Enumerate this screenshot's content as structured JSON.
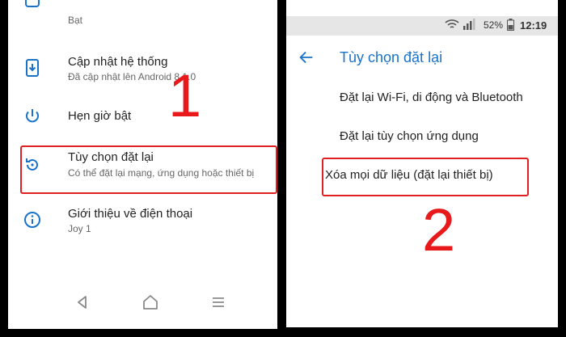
{
  "left": {
    "partial_item": {
      "subtitle": "Bạt"
    },
    "items": [
      {
        "title": "Cập nhật hệ thống",
        "subtitle": "Đã cập nhật lên Android 8.1.0",
        "icon": "system-update-icon"
      },
      {
        "title": "Hẹn giờ bật",
        "subtitle": "",
        "icon": "power-icon"
      },
      {
        "title": "Tùy chọn đặt lại",
        "subtitle": "Có thể đặt lại mạng, ứng dụng hoặc thiết bị",
        "icon": "reset-icon"
      },
      {
        "title": "Giới thiệu về điện thoại",
        "subtitle": "Joy 1",
        "icon": "info-icon"
      }
    ],
    "step_number": "1",
    "nav": {
      "back": "back-icon",
      "home": "home-icon",
      "menu": "menu-icon"
    }
  },
  "right": {
    "status": {
      "battery": "52%",
      "time": "12:19"
    },
    "title": "Tùy chọn đặt lại",
    "options": [
      "Đặt lại Wi-Fi, di động và Bluetooth",
      "Đặt lại tùy chọn ứng dụng",
      "Xóa mọi dữ liệu (đặt lại thiết bị)"
    ],
    "step_number": "2"
  },
  "colors": {
    "accent": "#1a73c8",
    "highlight": "#e02020",
    "step": "#e8191a"
  }
}
